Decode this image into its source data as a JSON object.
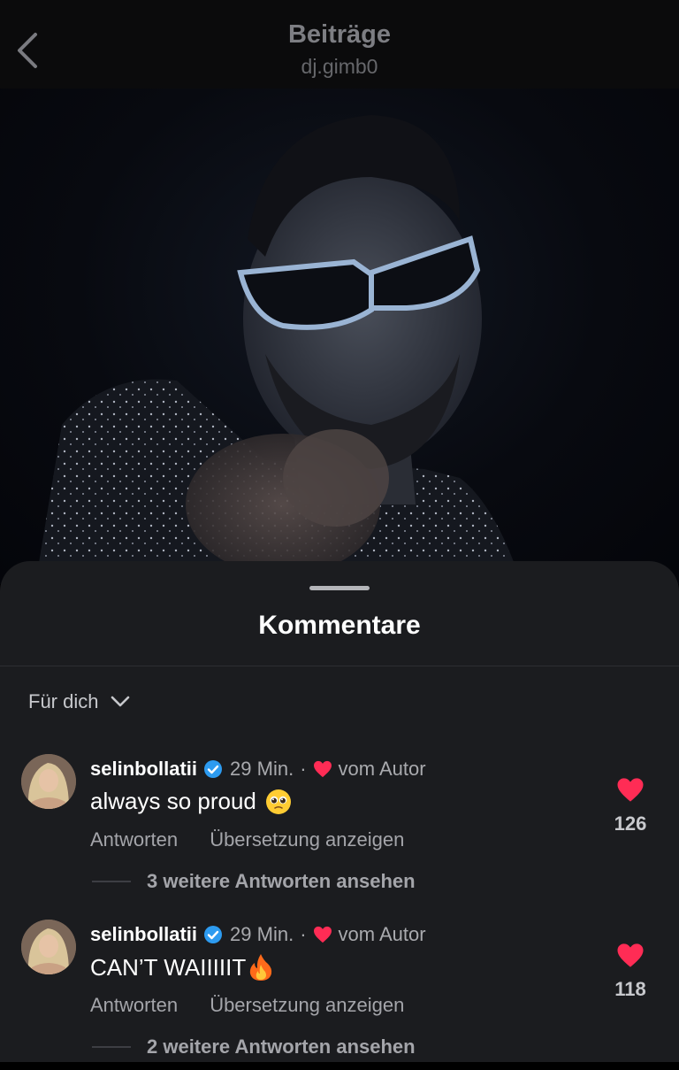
{
  "header": {
    "title": "Beiträge",
    "subtitle": "dj.gimb0"
  },
  "sheet": {
    "title": "Kommentare",
    "sort_label": "Für dich"
  },
  "comments": [
    {
      "username": "selinbollatii",
      "time": "29 Min.",
      "separator": "·",
      "author_label": "vom Autor",
      "text": "always so proud",
      "emoji": "pleading-face",
      "reply_label": "Antworten",
      "translate_label": "Übersetzung anzeigen",
      "more_replies": "3 weitere Antworten ansehen",
      "likes": "126"
    },
    {
      "username": "selinbollatii",
      "time": "29 Min.",
      "separator": "·",
      "author_label": "vom Autor",
      "text": "CAN’T WAIIIIIT",
      "emoji": "fire",
      "reply_label": "Antworten",
      "translate_label": "Übersetzung anzeigen",
      "more_replies": "2 weitere Antworten ansehen",
      "likes": "118"
    }
  ],
  "colors": {
    "like_red": "#ff2c55",
    "verified_blue": "#2d9bf0",
    "sheet_bg": "#1b1c1f",
    "header_text": "#7d7e83"
  },
  "icons": {
    "back": "chevron-left-icon",
    "sort": "chevron-down-icon",
    "verified": "verified-badge-icon",
    "like": "heart-icon"
  }
}
